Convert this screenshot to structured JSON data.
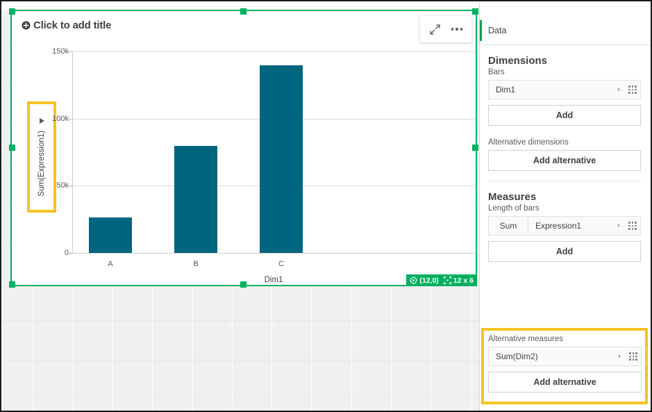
{
  "chart_object": {
    "title_placeholder": "Click to add title",
    "add_title_icon": "plus-circle-icon",
    "tools": {
      "fullscreen_icon": "expand-arrows-icon",
      "menu_icon": "ellipsis-icon"
    },
    "status": {
      "position_icon": "target-icon",
      "position": "(12,0)",
      "size_icon": "resize-grid-icon",
      "size": "12 x 6"
    },
    "selection_color": "#00b060"
  },
  "chart_data": {
    "type": "bar",
    "title": "",
    "categories": [
      "A",
      "B",
      "C"
    ],
    "values": [
      27000,
      82000,
      144000
    ],
    "series": [
      {
        "name": "Sum(Expression1)",
        "values": [
          27000,
          82000,
          144000
        ]
      }
    ],
    "xlabel": "Dim1",
    "ylabel": "Sum(Expression1)",
    "ylim": [
      0,
      155000
    ],
    "ytick_labels": [
      "0",
      "50k",
      "100k",
      "150k"
    ],
    "ytick_values": [
      0,
      50000,
      100000,
      150000
    ],
    "grid": true,
    "legend": "none",
    "bar_color": "#00657f",
    "ylabel_expand_icon": "triangle-right-icon",
    "ylabel_highlighted": true,
    "highlight_color": "#f7c223"
  },
  "panel": {
    "header": "Data",
    "dimensions": {
      "title": "Dimensions",
      "sub_label": "Bars",
      "items": [
        {
          "name": "Dim1",
          "chevron_icon": "chevron-right-icon",
          "grip_icon": "drag-grip-icon"
        }
      ],
      "add_label": "Add",
      "alternative_label": "Alternative dimensions",
      "add_alternative_label": "Add alternative"
    },
    "measures": {
      "title": "Measures",
      "sub_label": "Length of bars",
      "items": [
        {
          "aggregation": "Sum",
          "name": "Expression1",
          "chevron_icon": "chevron-right-icon",
          "grip_icon": "drag-grip-icon"
        }
      ],
      "add_label": "Add",
      "alternative_label": "Alternative measures",
      "alternative_items": [
        {
          "name": "Sum(Dim2)",
          "chevron_icon": "chevron-right-icon",
          "grip_icon": "drag-grip-icon"
        }
      ],
      "add_alternative_label": "Add alternative",
      "highlighted": true,
      "highlight_color": "#f7c223"
    }
  }
}
